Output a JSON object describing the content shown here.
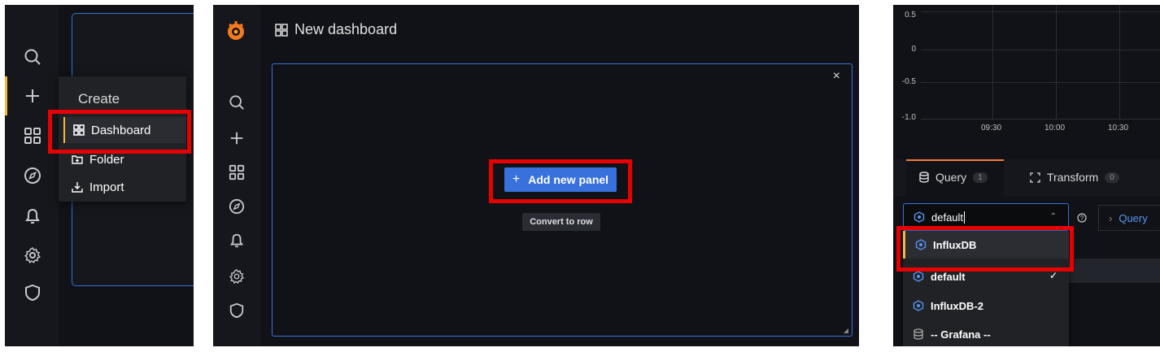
{
  "panel1": {
    "menu": {
      "title": "Create",
      "items": [
        {
          "label": "Dashboard",
          "icon": "apps-icon"
        },
        {
          "label": "Folder",
          "icon": "folder-plus-icon"
        },
        {
          "label": "Import",
          "icon": "import-icon"
        }
      ]
    }
  },
  "panel2": {
    "header_title": "New dashboard",
    "add_panel_label": "Add new panel",
    "convert_label": "Convert to row",
    "close_symbol": "×"
  },
  "panel3": {
    "y_ticks": [
      "0.5",
      "0",
      "-0.5",
      "-1.0"
    ],
    "x_ticks": [
      "09:30",
      "10:00",
      "10:30"
    ],
    "tabs": {
      "query": {
        "label": "Query",
        "count": "1"
      },
      "transform": {
        "label": "Transform",
        "count": "0"
      }
    },
    "datasource_input": {
      "value": "default"
    },
    "query_link": "Query",
    "dropdown": [
      {
        "label": "InfluxDB",
        "icon": "influxdb-icon",
        "selected": false
      },
      {
        "label": "default",
        "icon": "influxdb-icon",
        "selected": true
      },
      {
        "label": "InfluxDB-2",
        "icon": "influxdb-icon",
        "selected": false
      },
      {
        "label": "-- Grafana --",
        "icon": "database-icon",
        "selected": false
      }
    ]
  },
  "colors": {
    "accent_blue": "#3871dc",
    "highlight_red": "#e60000",
    "active_orange": "#f5b73d",
    "bg_dark": "#111217"
  }
}
